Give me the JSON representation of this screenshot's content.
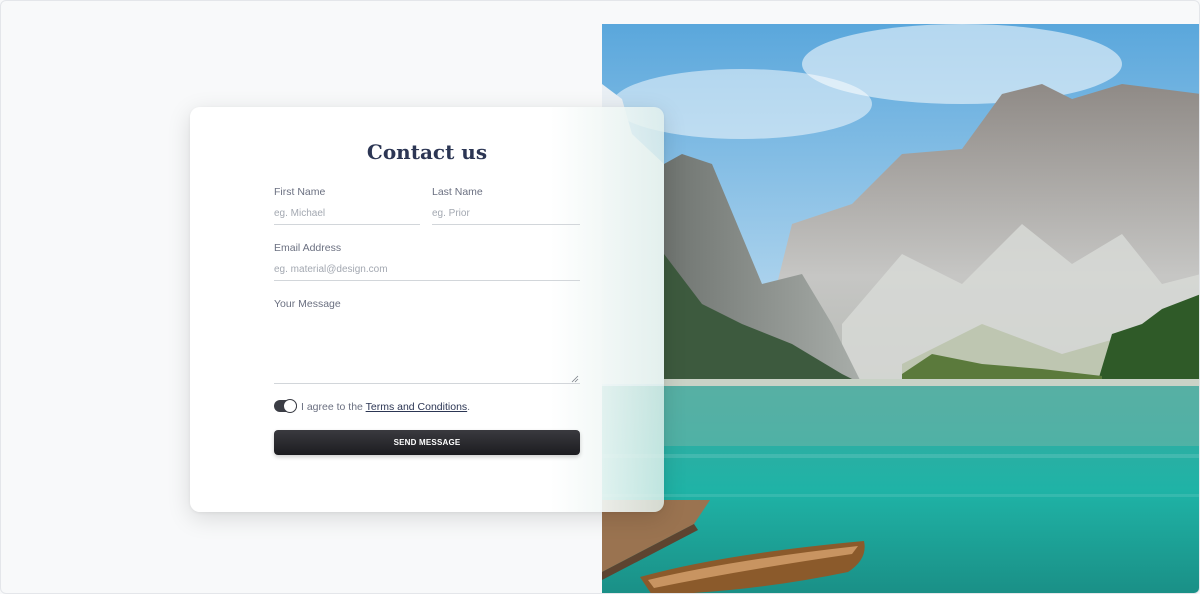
{
  "contact": {
    "title": "Contact us",
    "first_name": {
      "label": "First Name",
      "placeholder": "eg. Michael"
    },
    "last_name": {
      "label": "Last Name",
      "placeholder": "eg. Prior"
    },
    "email": {
      "label": "Email Address",
      "placeholder": "eg. material@design.com"
    },
    "message": {
      "label": "Your Message"
    },
    "agree": {
      "prefix": "I agree to the ",
      "link": "Terms and Conditions",
      "suffix": ".",
      "checked": true
    },
    "submit_label": "SEND MESSAGE"
  },
  "image": {
    "subject": "mountain-lake-landscape-image"
  },
  "colors": {
    "accent": "#2c3654",
    "button": "#1c1c20",
    "lake": "#2ba89c"
  }
}
